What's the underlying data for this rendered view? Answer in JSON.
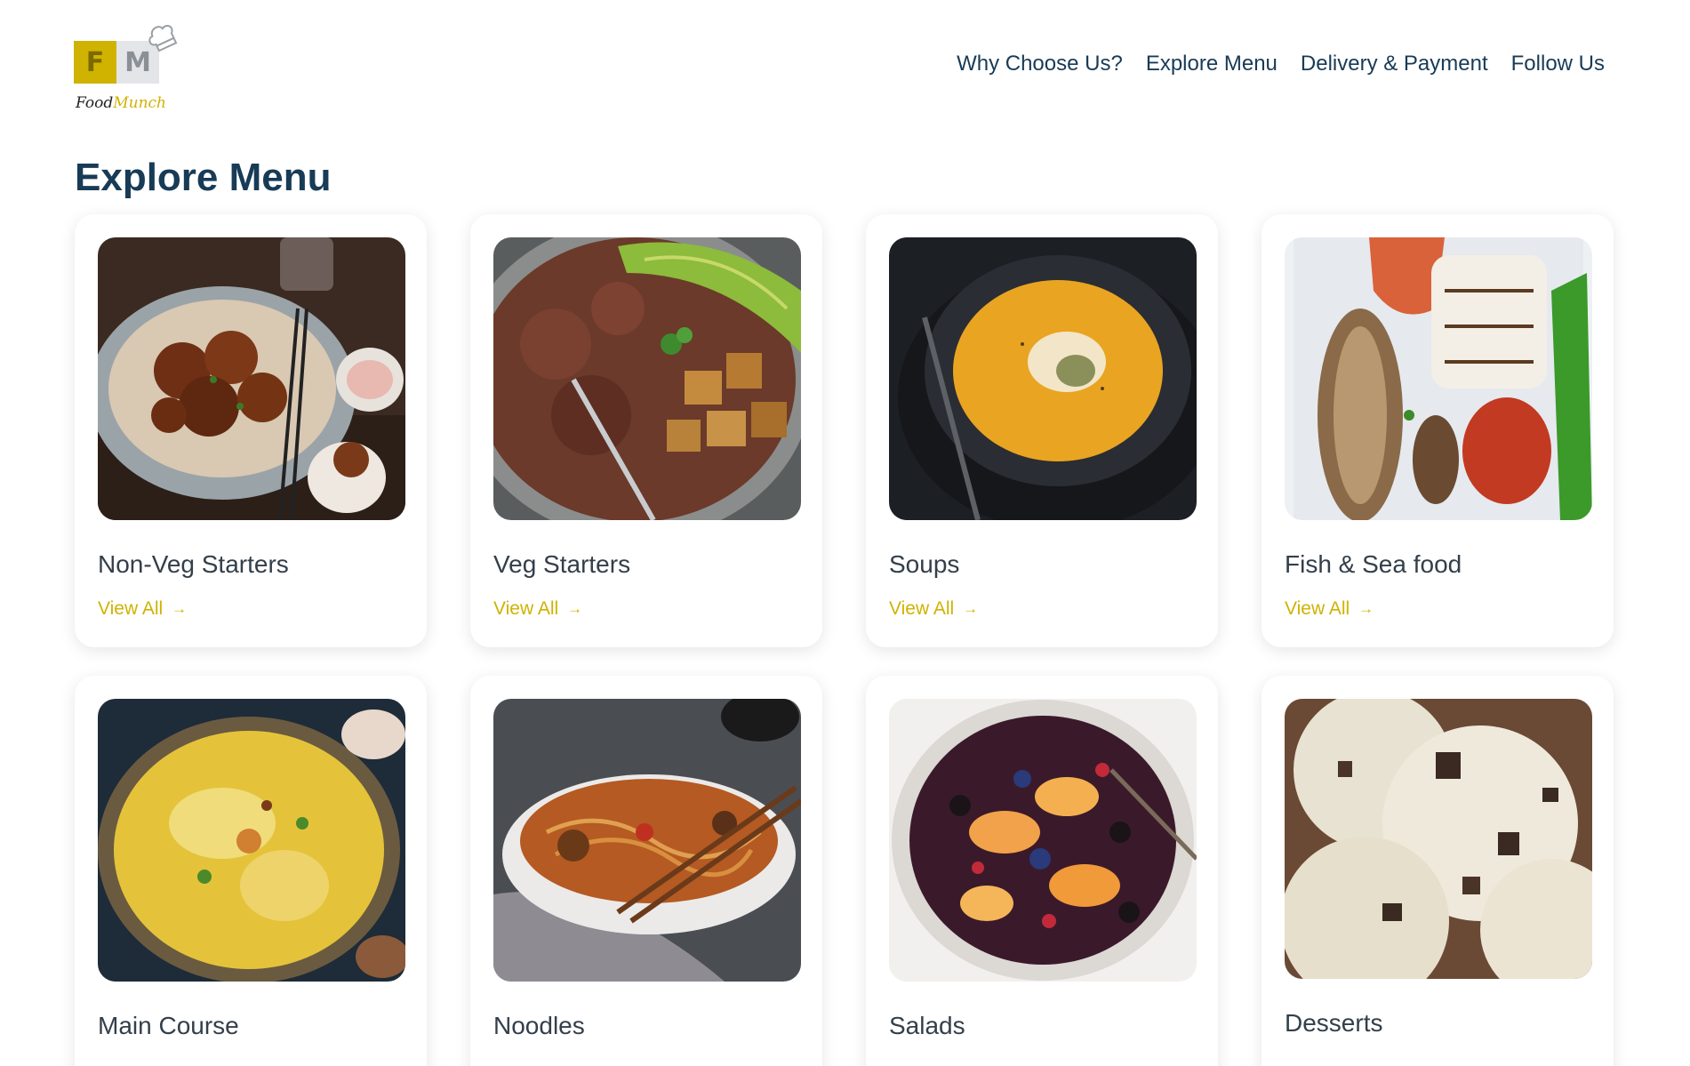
{
  "brand": {
    "name_part1": "Food",
    "name_part2": "Munch",
    "logo_letters": [
      "F",
      "M"
    ]
  },
  "nav": {
    "items": [
      "Why Choose Us?",
      "Explore Menu",
      "Delivery & Payment",
      "Follow Us"
    ]
  },
  "page": {
    "title": "Explore Menu"
  },
  "menu": {
    "view_all_label": "View All",
    "cards": [
      {
        "title": "Non-Veg Starters",
        "image": "fried chicken starter plate",
        "link": "View All"
      },
      {
        "title": "Veg Starters",
        "image": "tofu avocado grain bowl",
        "link": "View All"
      },
      {
        "title": "Soups",
        "image": "pumpkin soup bowl",
        "link": "View All"
      },
      {
        "title": "Fish & Sea food",
        "image": "grilled fish and squid platter",
        "link": "View All"
      },
      {
        "title": "Main Course",
        "image": "biryani rice dish",
        "link": ""
      },
      {
        "title": "Noodles",
        "image": "noodle bowl with chopsticks",
        "link": ""
      },
      {
        "title": "Salads",
        "image": "fruit salad bowl",
        "link": ""
      },
      {
        "title": "Desserts",
        "image": "chocolate chip ice cream scoops",
        "link": ""
      }
    ]
  },
  "colors": {
    "heading": "#183b56",
    "accent": "#d0b200",
    "text": "#333f4a"
  }
}
